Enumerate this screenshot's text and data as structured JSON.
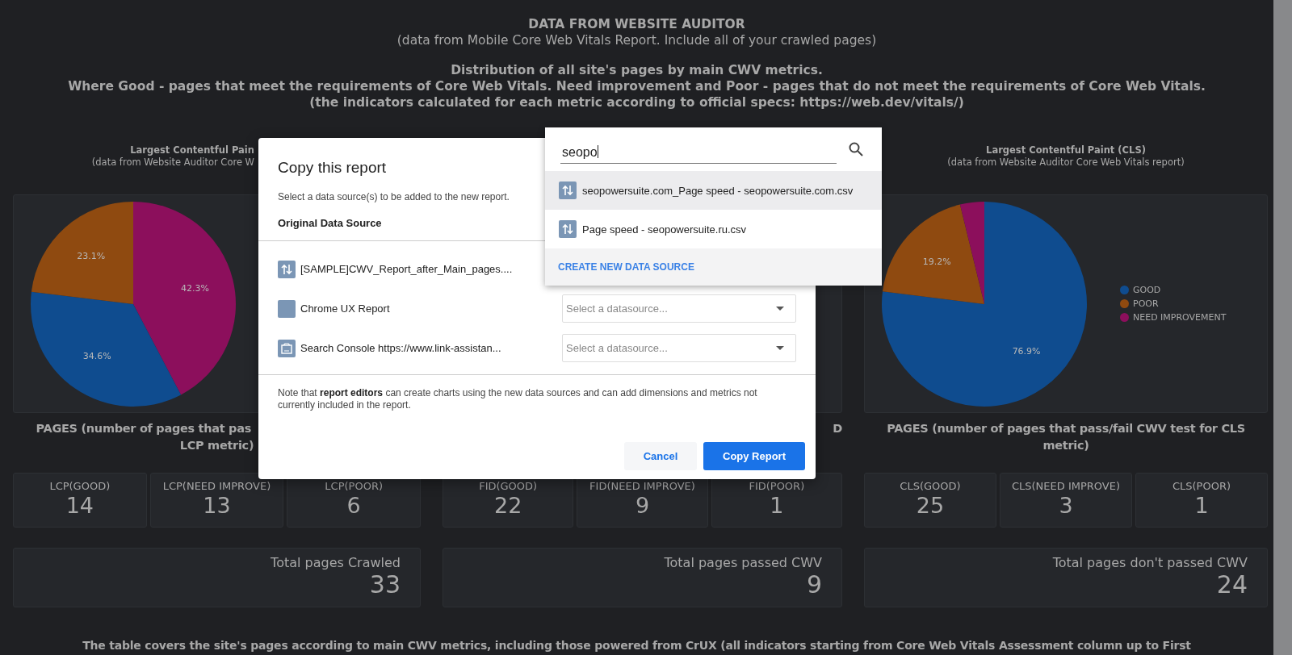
{
  "header": {
    "title": "DATA FROM WEBSITE AUDITOR",
    "subtitle": "(data from Mobile Core Web Vitals Report. Include all of your crawled pages)",
    "lines": [
      "Distribution of all site's pages by main CWV metrics.",
      "Where Good - pages that meet the requirements of Core Web Vitals. Need improvement and Poor - pages that do not meet the requirements of Core Web Vitals.",
      "(the indicators calculated for each metric according to official specs: https://web.dev/vitals/)"
    ]
  },
  "columns": [
    {
      "chart_title": "Largest Contentful Pain",
      "chart_subtitle": "(data from Website Auditor Core W",
      "chart_data": {
        "type": "pie",
        "values": [
          42.3,
          34.6,
          23.1
        ],
        "colors": [
          "#8c0f5c",
          "#0f4c8f",
          "#8f4a10"
        ],
        "value_labels": [
          "42.3%",
          "34.6%",
          "23.1%"
        ]
      },
      "pages_heading": [
        "PAGES (number of pages that pas",
        "LCP metric)"
      ],
      "kpis": [
        {
          "label": "LCP(GOOD)",
          "value": "14"
        },
        {
          "label": "LCP(NEED IMPROVE)",
          "value": "13"
        },
        {
          "label": "LCP(POOR)",
          "value": "6"
        }
      ],
      "total": {
        "label": "Total pages Crawled",
        "value": "33"
      }
    },
    {
      "pages_heading": [
        "D"
      ],
      "kpis": [
        {
          "label": "FID(GOOD)",
          "value": "22"
        },
        {
          "label": "FID(NEED IMPROVE)",
          "value": "9"
        },
        {
          "label": "FID(POOR)",
          "value": "1"
        }
      ],
      "total": {
        "label": "Total pages passed CWV",
        "value": "9"
      }
    },
    {
      "chart_title": "Largest Contentful Paint (CLS)",
      "chart_subtitle": "(data from Website Auditor Core Web Vitals report)",
      "chart_data": {
        "type": "pie",
        "categories": [
          "GOOD",
          "POOR",
          "NEED IMPROVEMENT"
        ],
        "values": [
          76.9,
          19.2,
          3.8
        ],
        "colors": [
          "#0f4c8f",
          "#8f4a10",
          "#8c0f5c"
        ],
        "value_labels": [
          "76.9%",
          "19.2%",
          null
        ]
      },
      "pages_heading": [
        "PAGES (number of pages that pass/fail CWV test for CLS",
        "metric)"
      ],
      "kpis": [
        {
          "label": "CLS(GOOD)",
          "value": "25"
        },
        {
          "label": "CLS(NEED IMPROVE)",
          "value": "3"
        },
        {
          "label": "CLS(POOR)",
          "value": "1"
        }
      ],
      "total": {
        "label": "Total pages don't passed CWV",
        "value": "24"
      }
    }
  ],
  "footer_text": "The table covers the site's pages according to main CWV metrics, including those powered from CrUX (all indicators starting from Core Web Vitals Assessment column up to First",
  "dialog": {
    "title": "Copy this report",
    "subtitle": "Select a data source(s) to be added to the new report.",
    "column_heading": "Original Data Source",
    "sources": [
      {
        "kind": "file",
        "name": "[SAMPLE]CWV_Report_after_Main_pages...."
      },
      {
        "kind": "plain",
        "name": "Chrome UX Report",
        "select_placeholder": "Select a datasource..."
      },
      {
        "kind": "console",
        "name": "Search Console https://www.link-assistan...",
        "select_placeholder": "Select a datasource..."
      }
    ],
    "note": "Note that **report editors** can create charts using the new data sources and can add dimensions and metrics not currently included in the report.",
    "buttons": [
      {
        "kind": "secondary",
        "label": "Cancel"
      },
      {
        "kind": "primary",
        "label": "Copy Report"
      }
    ]
  },
  "dropdown": {
    "search_value": "seopo",
    "options": [
      {
        "kind": "file",
        "label": "seopowersuite.com_Page speed - seopowersuite.com.csv",
        "selected": true
      },
      {
        "kind": "file",
        "label": "Page speed - seopowersuite.ru.csv",
        "selected": false
      }
    ],
    "create_link": "CREATE NEW DATA SOURCE"
  }
}
